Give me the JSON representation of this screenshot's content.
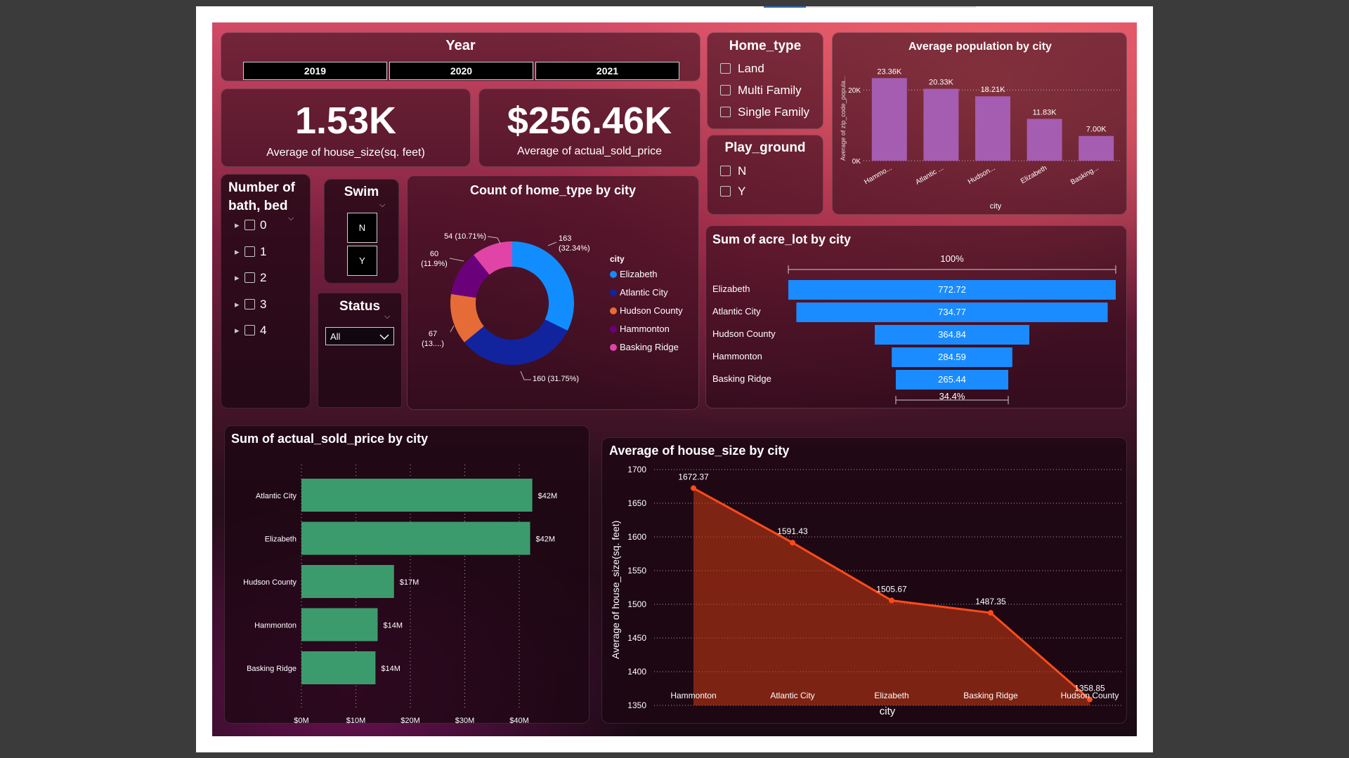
{
  "year_slicer": {
    "title": "Year",
    "options": [
      "2019",
      "2020",
      "2021"
    ]
  },
  "kpis": [
    {
      "value": "1.53K",
      "label": "Average of house_size(sq. feet)"
    },
    {
      "value": "$256.46K",
      "label": "Average of actual_sold_price"
    }
  ],
  "home_type_slicer": {
    "title": "Home_type",
    "options": [
      "Land",
      "Multi Family",
      "Single Family"
    ]
  },
  "playground_slicer": {
    "title": "Play_ground",
    "options": [
      "N",
      "Y"
    ]
  },
  "bath_bed_slicer": {
    "title": "Number of bath, bed",
    "options": [
      "0",
      "1",
      "2",
      "3",
      "4"
    ]
  },
  "swim_slicer": {
    "title": "Swim",
    "options": [
      "N",
      "Y"
    ]
  },
  "status_slicer": {
    "title": "Status",
    "selected": "All"
  },
  "colors": {
    "accent_blue": "#1a8cff",
    "green_bars": "#3c9b6d",
    "purple_bars": "#a45db0",
    "line_orange": "#ff4a1c"
  },
  "chart_data": [
    {
      "id": "avg_population",
      "type": "bar",
      "title": "Average population by city",
      "xlabel": "city",
      "ylabel": "Average of zip_code_popula...",
      "categories": [
        "Hammo...",
        "Atlantic ...",
        "Hudson...",
        "Elizabeth",
        "Basking..."
      ],
      "values": [
        23360,
        20330,
        18210,
        11830,
        7000
      ],
      "data_labels": [
        "23.36K",
        "20.33K",
        "18.21K",
        "11.83K",
        "7.00K"
      ],
      "y_ticks": [
        "0K",
        "20K"
      ],
      "ylim": [
        0,
        25000
      ]
    },
    {
      "id": "home_type_donut",
      "type": "pie",
      "title": "Count of home_type by city",
      "legend_title": "city",
      "legend_placement": "right",
      "categories": [
        "Elizabeth",
        "Atlantic City",
        "Hudson County",
        "Hammonton",
        "Basking Ridge"
      ],
      "values": [
        163,
        160,
        67,
        60,
        54
      ],
      "colors": [
        "#118dff",
        "#12239e",
        "#e66c37",
        "#6b007b",
        "#e044a7"
      ],
      "data_labels": [
        [
          "163",
          "(32.34%)"
        ],
        [
          "160 (31.75%)"
        ],
        [
          "67",
          "(13....)"
        ],
        [
          "60",
          "(11.9%)"
        ],
        [
          "54 (10.71%)"
        ]
      ]
    },
    {
      "id": "acre_lot_funnel",
      "type": "bar",
      "title": "Sum of acre_lot by city",
      "categories": [
        "Elizabeth",
        "Atlantic City",
        "Hudson County",
        "Hammonton",
        "Basking Ridge"
      ],
      "values": [
        772.72,
        734.77,
        364.84,
        284.59,
        265.44
      ],
      "data_labels": [
        "772.72",
        "734.77",
        "364.84",
        "284.59",
        "265.44"
      ],
      "top_percent_label": "100%",
      "bottom_percent_label": "34.4%"
    },
    {
      "id": "sold_price_bar",
      "type": "bar",
      "title": "Sum of actual_sold_price by city",
      "categories": [
        "Atlantic City",
        "Elizabeth",
        "Hudson County",
        "Hammonton",
        "Basking Ridge"
      ],
      "values": [
        42.4,
        42.0,
        17.0,
        14.0,
        13.6
      ],
      "data_labels": [
        "$42M",
        "$42M",
        "$17M",
        "$14M",
        "$14M"
      ],
      "x_ticks": [
        "$0M",
        "$10M",
        "$20M",
        "$30M",
        "$40M"
      ],
      "xlim": [
        0,
        47.5
      ]
    },
    {
      "id": "house_size_area",
      "type": "area",
      "title": "Average of house_size by city",
      "xlabel": "city",
      "ylabel": "Average of house_size(sq. feet)",
      "categories": [
        "Hammonton",
        "Atlantic City",
        "Elizabeth",
        "Basking Ridge",
        "Hudson County"
      ],
      "values": [
        1672.37,
        1591.43,
        1505.67,
        1487.35,
        1358.85
      ],
      "data_labels": [
        "1672.37",
        "1591.43",
        "1505.67",
        "1487.35",
        "1358.85"
      ],
      "y_ticks": [
        "1350",
        "1400",
        "1450",
        "1500",
        "1550",
        "1600",
        "1650",
        "1700"
      ],
      "ylim": [
        1350,
        1700
      ]
    }
  ]
}
